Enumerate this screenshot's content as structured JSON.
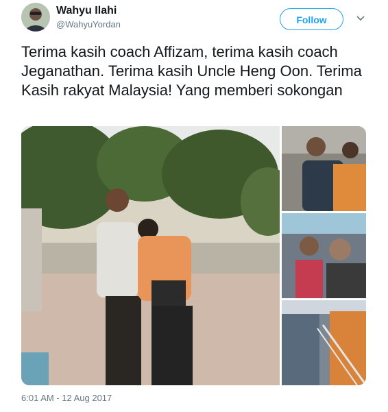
{
  "author": {
    "name": "Wahyu Ilahi",
    "handle": "@WahyuYordan",
    "avatar_icon": "user-avatar-photo"
  },
  "actions": {
    "follow_label": "Follow",
    "more_icon": "chevron-down-icon"
  },
  "tweet": {
    "text": "Terima kasih coach Affizam, terima kasih coach Jeganathan. Terima kasih Uncle Heng Oon. Terima Kasih rakyat Malaysia! Yang memberi sokongan",
    "timestamp": "6:01 AM - 12 Aug 2017"
  },
  "media": {
    "photo_count": 4
  },
  "colors": {
    "accent": "#1da1f2",
    "text": "#14171a",
    "secondary": "#657786"
  }
}
